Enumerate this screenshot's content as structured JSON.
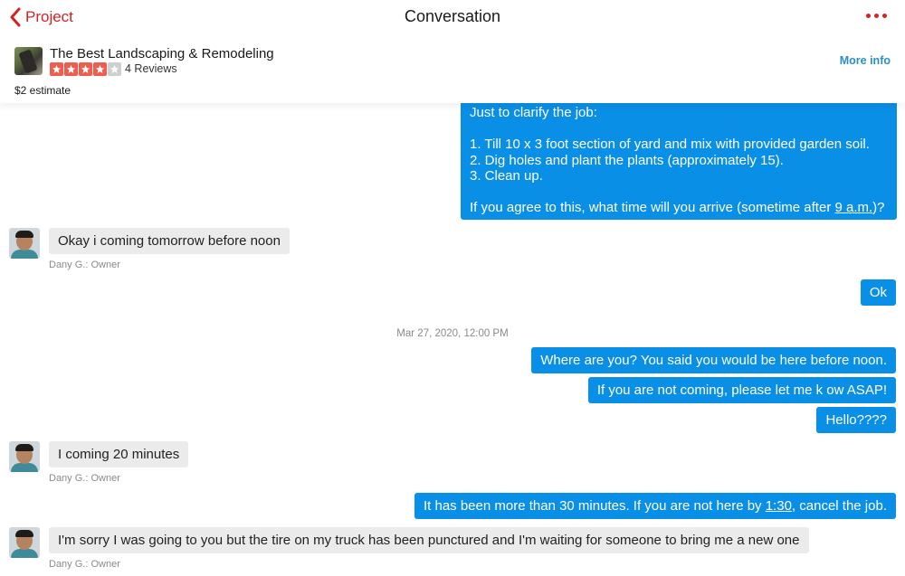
{
  "nav": {
    "back_label": "Project",
    "title": "Conversation"
  },
  "business": {
    "name": "The Best Landscaping & Remodeling",
    "rating": 4,
    "rating_max": 5,
    "reviews": "4 Reviews",
    "estimate": "$2 estimate",
    "more_info": "More info"
  },
  "colors": {
    "accent_red": "#d32323",
    "outgoing_bubble": "#0a8fe6",
    "incoming_bubble": "#ebebeb",
    "link_blue": "#2a8fc8"
  },
  "messages": {
    "m1": {
      "line1": "Just to clarify the job:",
      "line2": "1. Till 10 x 3 foot section of yard and mix with provided garden soil.",
      "line3": "2. Dig holes and plant the plants (approximately 15).",
      "line4": "3. Clean up.",
      "line5_pre": "If you agree to this, what time will you arrive (sometime after ",
      "line5_link": "9 a.m.",
      "line5_post": ")?"
    },
    "m2": {
      "text": "Okay i coming tomorrow before noon",
      "sender": "Dany G.: Owner"
    },
    "m3": {
      "text": "Ok"
    },
    "timestamp": "Mar 27, 2020, 12:00 PM",
    "m4": {
      "text": "Where are you? You said you would be here before noon."
    },
    "m5": {
      "text": "If you are not coming, please let me k ow ASAP!"
    },
    "m6": {
      "text": "Hello????"
    },
    "m7": {
      "text": "I coming 20 minutes",
      "sender": "Dany G.: Owner"
    },
    "m8": {
      "pre": "It has been more than 30 minutes. If you are not here by ",
      "link": "1:30",
      "post": ", cancel the job."
    },
    "m9": {
      "text": "I'm sorry I was going to you but the tire on my truck has been punctured and I'm waiting for someone to bring me a new one",
      "sender": "Dany G.: Owner"
    }
  }
}
